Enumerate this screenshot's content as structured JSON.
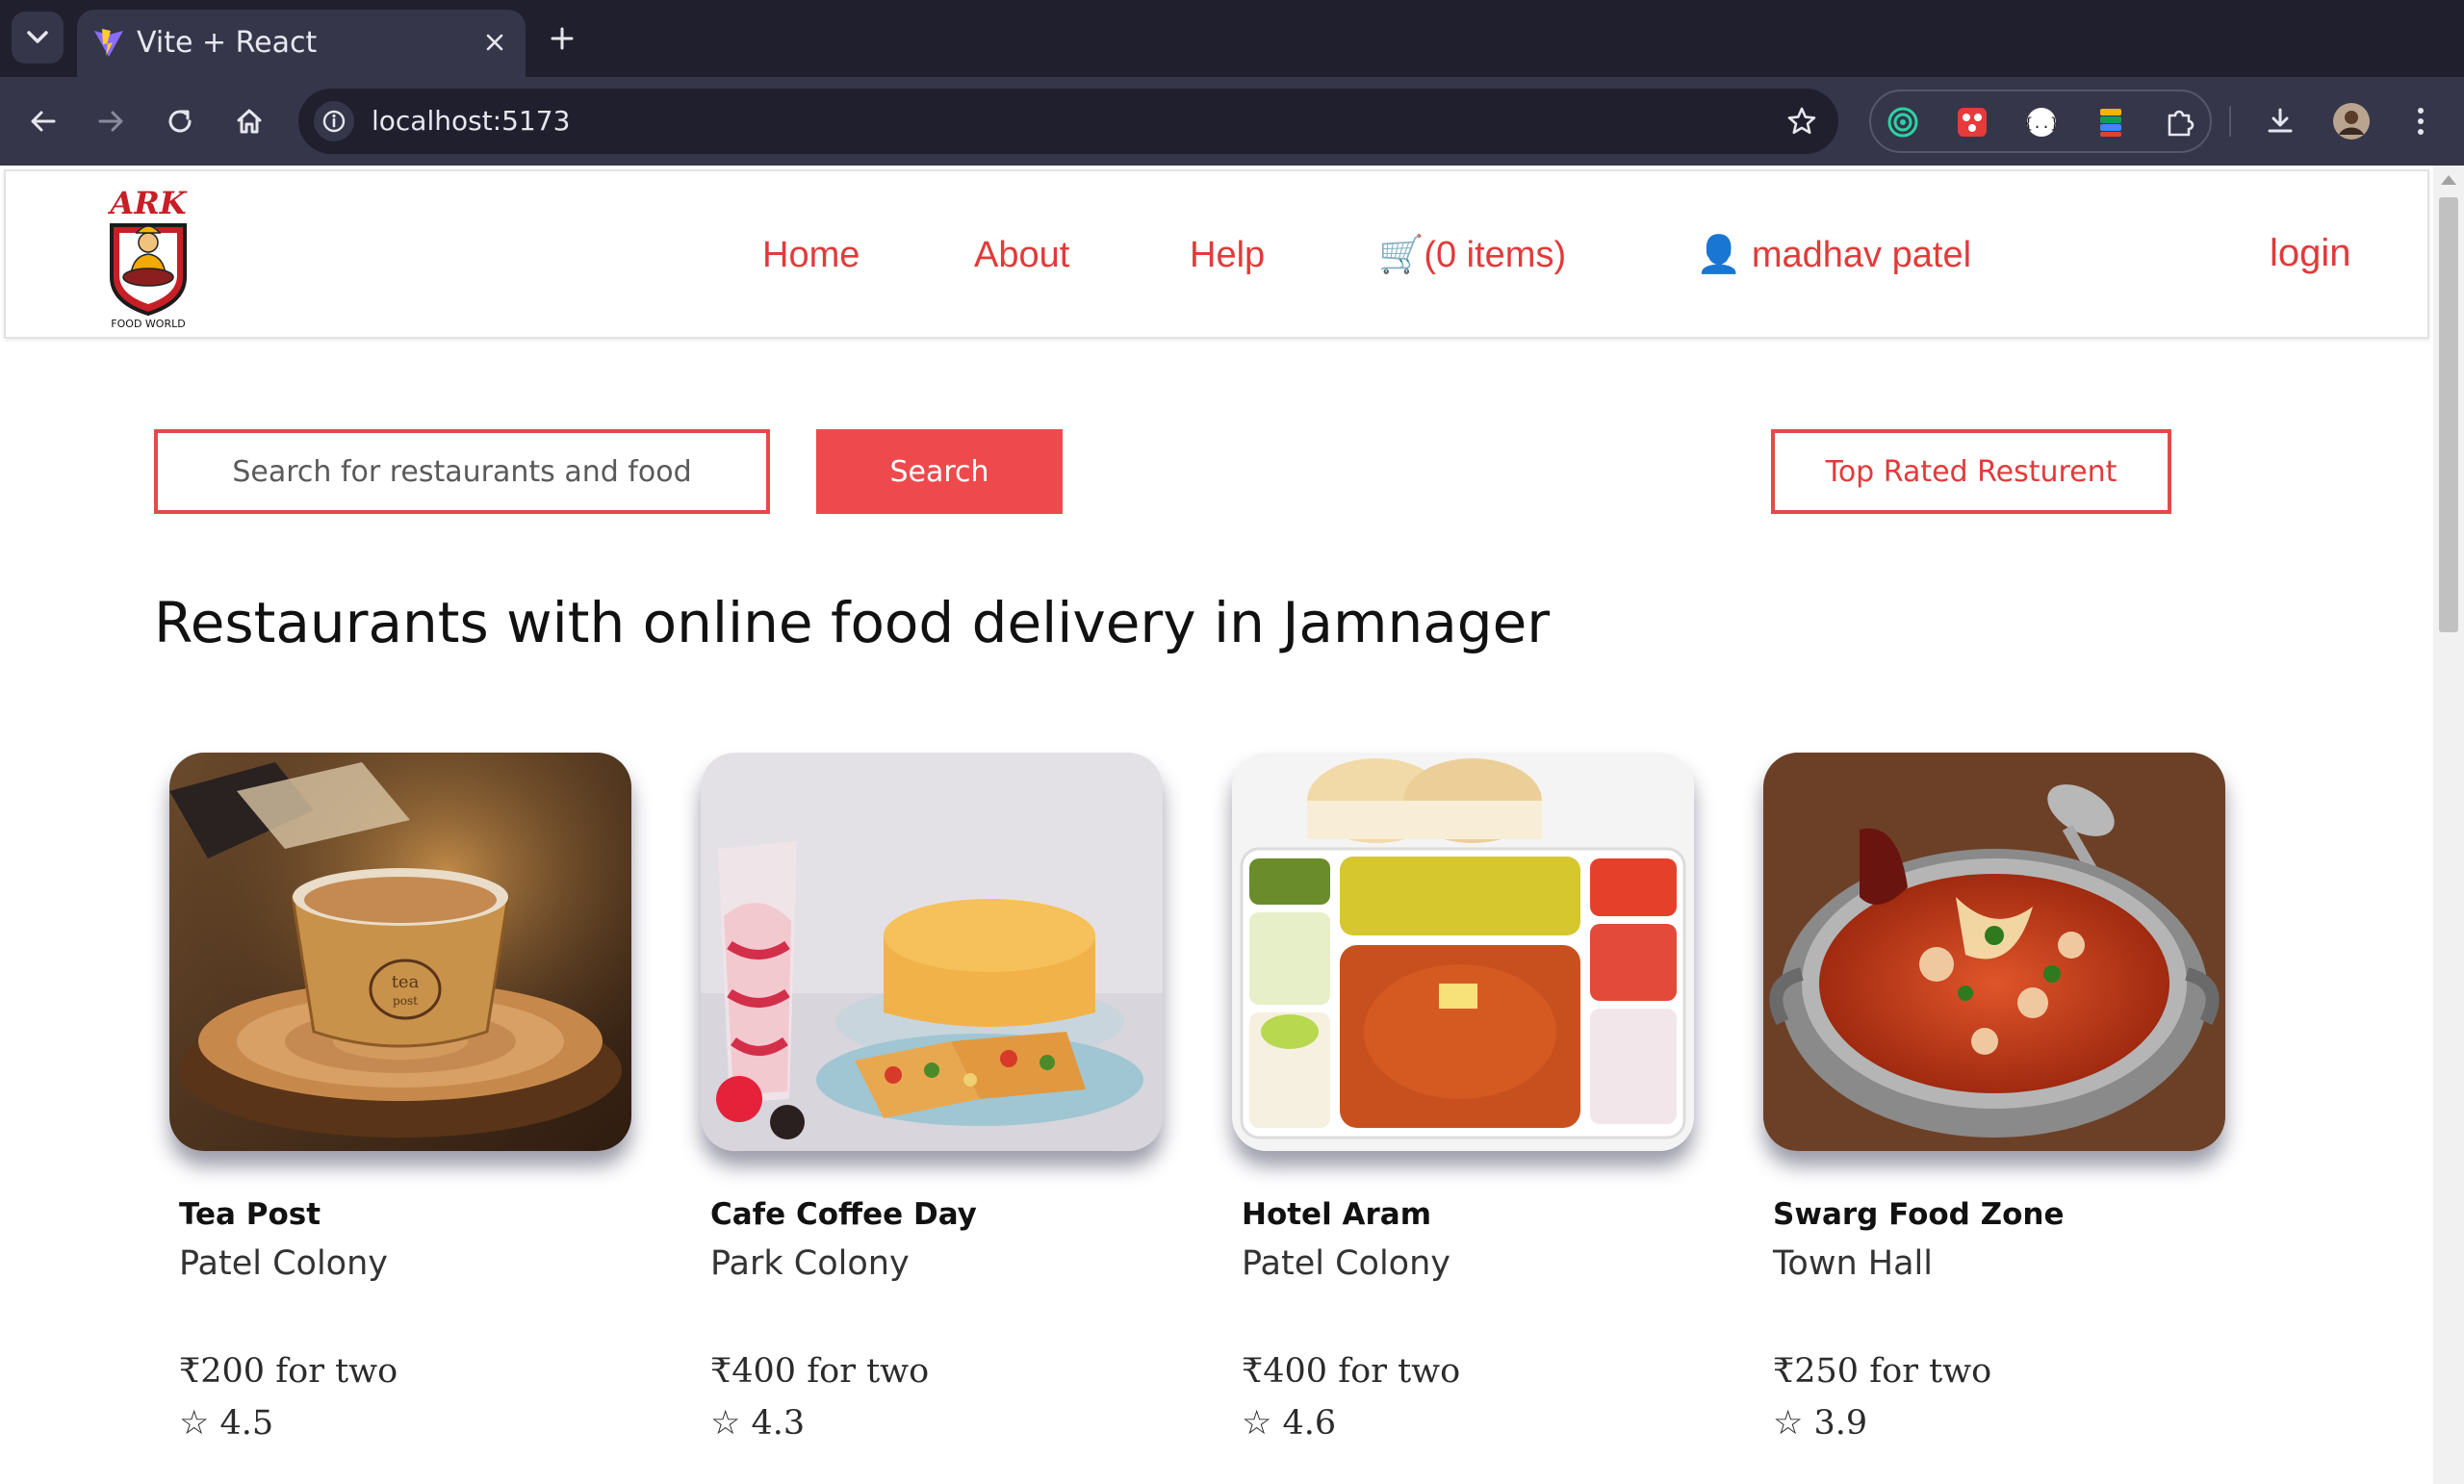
{
  "browser": {
    "tab_title": "Vite + React",
    "url": "localhost:5173"
  },
  "header": {
    "logo_brand": "ARK",
    "logo_tagline": "FOOD WORLD",
    "nav": {
      "home": "Home",
      "about": "About",
      "help": "Help",
      "cart": "🛒(0 items)",
      "user": "👤 madhav patel"
    },
    "login": "login"
  },
  "search": {
    "placeholder": "Search for restaurants and food",
    "button": "Search",
    "top_rated": "Top Rated Resturent"
  },
  "heading": "Restaurants with online food delivery in Jamnager",
  "restaurants": [
    {
      "name": "Tea Post",
      "area": "Patel Colony",
      "price": "₹200 for two",
      "rating": "☆ 4.5"
    },
    {
      "name": "Cafe Coffee Day",
      "area": "Park Colony",
      "price": "₹400 for two",
      "rating": "☆ 4.3"
    },
    {
      "name": "Hotel Aram",
      "area": "Patel Colony",
      "price": "₹400 for two",
      "rating": "☆ 4.6"
    },
    {
      "name": "Swarg Food Zone",
      "area": "Town Hall",
      "price": "₹250 for two",
      "rating": "☆ 3.9"
    }
  ],
  "colors": {
    "accent": "#ee4a4d",
    "chrome_dark": "#1f1f2e",
    "chrome_toolbar": "#35364a"
  }
}
